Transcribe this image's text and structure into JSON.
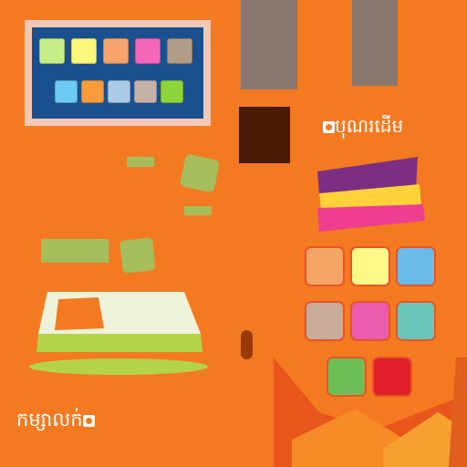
{
  "palette_top": {
    "row1": [
      "#c6ec86",
      "#fcf77b",
      "#f6a36d",
      "#f467b9",
      "#b39c87"
    ],
    "row2": [
      "#6cc9f3",
      "#f89b3b",
      "#a9cbe6",
      "#c5b1a6",
      "#8fd43b"
    ]
  },
  "labels": {
    "right_label": "បុណរដើម",
    "bottom_label": "កម្សាលក់"
  },
  "grid_colors": {
    "row1": [
      "#f4a565",
      "#fcf986",
      "#6bbbe9"
    ],
    "row2": [
      "#c8ac99",
      "#ec5cad",
      "#69c6b9"
    ],
    "row3": [
      "#6dbe54",
      "#e01f2a"
    ]
  },
  "colors": {
    "background": "#f37a20",
    "panel_blue": "#19508d",
    "panel_frame": "#f3c9b5",
    "strap": "#8a7770",
    "book_purple": "#7c2e83",
    "book_yellow": "#ffd23a",
    "book_pink": "#ef3e8f",
    "mat_cream": "#eef2d8",
    "mat_green": "#b5d34a",
    "mat_orange": "#f37a20"
  }
}
